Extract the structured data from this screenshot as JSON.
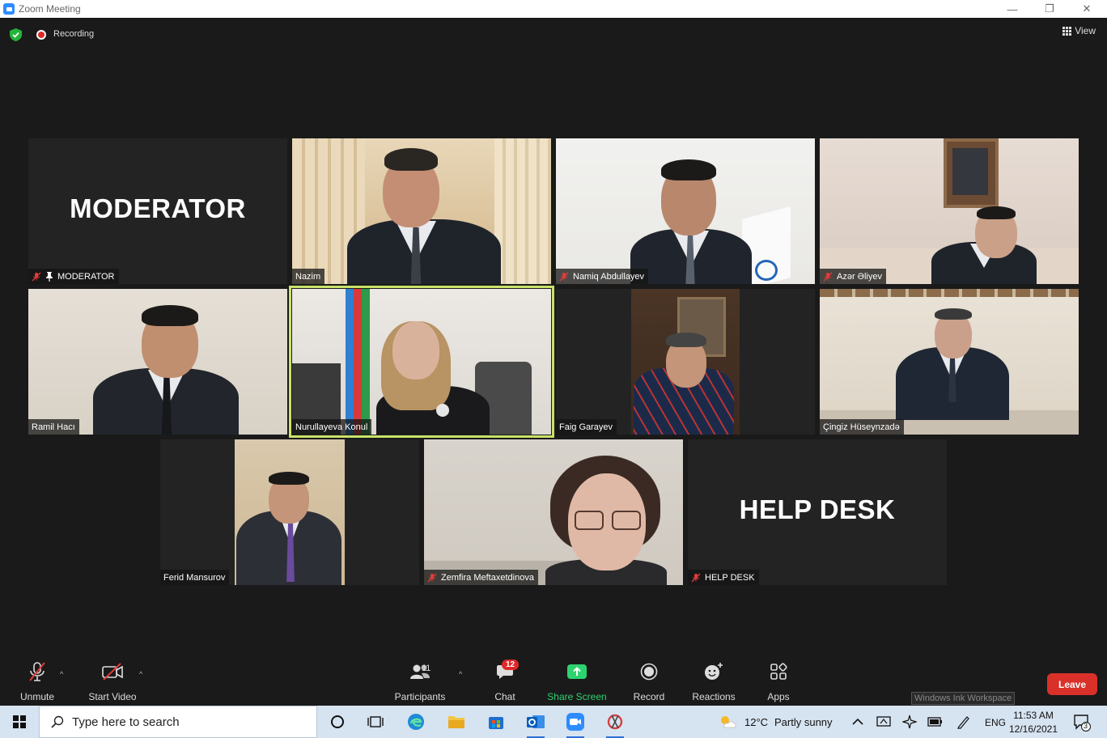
{
  "window": {
    "title": "Zoom Meeting",
    "minimize_glyph": "—",
    "restore_glyph": "❐",
    "close_glyph": "✕"
  },
  "meeting_bar": {
    "recording_label": "Recording",
    "view_label": "View"
  },
  "tiles": [
    {
      "name": "MODERATOR",
      "overlay_text": "MODERATOR",
      "muted": true,
      "pinned": true,
      "video": false
    },
    {
      "name": "Nazim",
      "muted": false,
      "video": true
    },
    {
      "name": "Namiq Abdullayev",
      "muted": true,
      "video": true
    },
    {
      "name": "Azər Əliyev",
      "muted": true,
      "video": true
    },
    {
      "name": "Ramil Hacı",
      "muted": false,
      "video": true
    },
    {
      "name": "Nurullayeva Konul",
      "muted": false,
      "video": true,
      "active_speaker": true
    },
    {
      "name": "Faig Garayev",
      "muted": false,
      "video": true
    },
    {
      "name": "Çingiz Hüseynzadə",
      "muted": false,
      "video": true
    },
    {
      "name": "Ferid Mansurov",
      "muted": false,
      "video": true
    },
    {
      "name": "Zemfira Meftaxetdinova",
      "muted": true,
      "video": true
    },
    {
      "name": "HELP DESK",
      "overlay_text": "HELP DESK",
      "muted": true,
      "video": false
    }
  ],
  "toolbar": {
    "unmute_label": "Unmute",
    "start_video_label": "Start Video",
    "participants_label": "Participants",
    "participants_count": "11",
    "chat_label": "Chat",
    "chat_badge": "12",
    "share_label": "Share Screen",
    "record_label": "Record",
    "reactions_label": "Reactions",
    "apps_label": "Apps",
    "leave_label": "Leave",
    "caret_glyph": "^",
    "ink_tooltip": "Windows Ink Workspace"
  },
  "taskbar": {
    "search_placeholder": "Type here to search",
    "weather_temp": "12°C",
    "weather_desc": "Partly sunny",
    "language": "ENG",
    "time": "11:53 AM",
    "date": "12/16/2021",
    "notification_count": "3"
  },
  "colors": {
    "active_speaker_border": "#c9e26a",
    "leave_button": "#d9312a",
    "share_green": "#2dd36f",
    "chat_badge": "#e02828",
    "taskbar_bg": "#d6e3f1"
  }
}
